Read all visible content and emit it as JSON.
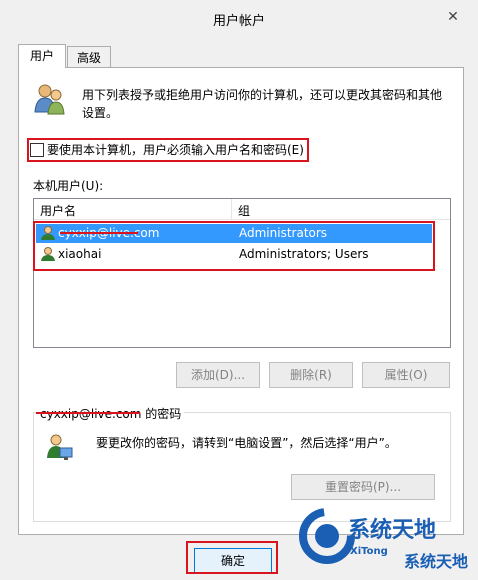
{
  "window": {
    "title": "用户帐户",
    "close_symbol": "✕"
  },
  "tabs": [
    {
      "label": "用户"
    },
    {
      "label": "高级"
    }
  ],
  "description": "用下列表授予或拒绝用户访问你的计算机，还可以更改其密码和其他设置。",
  "require_login_checkbox": {
    "label": "要使用本计算机，用户必须输入用户名和密码(E)",
    "checked": false
  },
  "users_section": {
    "label": "本机用户(U):",
    "columns": [
      "用户名",
      "组"
    ],
    "rows": [
      {
        "name": "cyxxip@live.com",
        "group": "Administrators",
        "selected": true
      },
      {
        "name": "xiaohai",
        "group": "Administrators; Users",
        "selected": false
      }
    ]
  },
  "buttons": {
    "add": "添加(D)...",
    "remove": "删除(R)",
    "properties": "属性(O)"
  },
  "password_section": {
    "account": "cyxxip@live.com",
    "suffix": " 的密码",
    "hint": "要更改你的密码，请转到“电脑设置”，然后选择“用户”。",
    "reset_button": "重置密码(P)..."
  },
  "footer": {
    "ok": "确定"
  },
  "watermark": {
    "text": "系统天地",
    "subtext": "XiTong"
  },
  "colors": {
    "highlight": "#3399ff",
    "annotation_red": "#d9141e",
    "watermark_blue": "#1a5fb4"
  }
}
